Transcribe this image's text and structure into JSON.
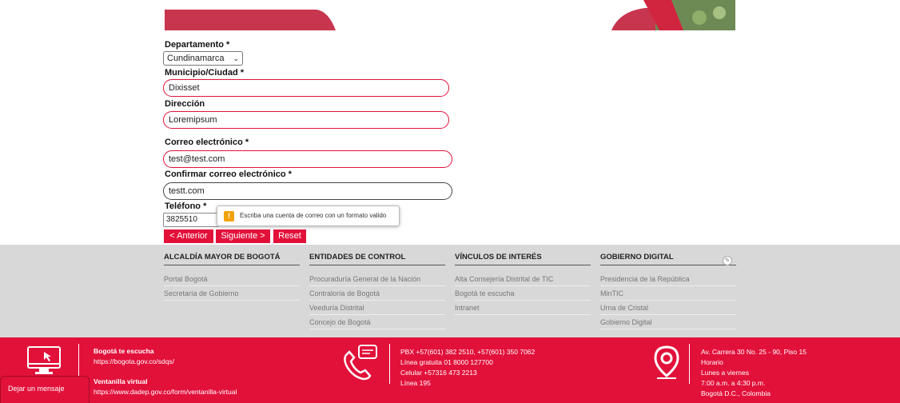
{
  "form": {
    "departamento_label": "Departamento",
    "departamento_value": "Cundinamarca",
    "municipio_label": "Municipio/Ciudad",
    "municipio_value": "Dixisset",
    "direccion_label": "Dirección",
    "direccion_value": "Loremipsum",
    "correo_label": "Correo electrónico",
    "correo_value": "test@test.com",
    "confirmar_label": "Confirmar correo electrónico",
    "confirmar_value": "testt.com",
    "telefono_label": "Teléfono",
    "telefono_value": "3825510",
    "required_mark": "*",
    "validation_tooltip": "Escriba una cuenta de correo con un formato valido",
    "buttons": {
      "anterior": "< Anterior",
      "siguiente": "Siguiente >",
      "reset": "Reset"
    }
  },
  "footer_nav": {
    "col1": {
      "title": "ALCALDÍA MAYOR DE BOGOTÁ",
      "items": [
        "Portal Bogotá",
        "Secretaría de Gobierno"
      ]
    },
    "col2": {
      "title": "ENTIDADES DE CONTROL",
      "items": [
        "Procuraduría General de la Nación",
        "Contraloría de Bogotá",
        "Veeduría Distrital",
        "Concejo de Bogotá"
      ]
    },
    "col3": {
      "title": "VÍNCULOS DE INTERÉS",
      "items": [
        "Alta Consejería Distrital de TIC",
        "Bogotá te escucha",
        "Intranet"
      ]
    },
    "col4": {
      "title": "GOBIERNO DIGITAL",
      "items": [
        "Presidencia de la República",
        "MinTIC",
        "Urna de Cristal",
        "Gobierno Digital"
      ]
    }
  },
  "footer_contact": {
    "bte_title": "Bogotá te escucha",
    "bte_url": "https://bogota.gov.co/sdqs/",
    "vv_title": "Ventanilla virtual",
    "vv_url": "https://www.dadep.gov.co/form/ventanilla-virtual",
    "pbx": "PBX +57(601) 382 2510, +57(601) 350 7062",
    "linea_gratuita": "Línea gratuita 01 8000 127700",
    "celular": "Celular +57316 473 2213",
    "linea195": "Línea 195",
    "address": "Av. Carrera 30 No. 25 - 90, Piso 15",
    "horario": "Horario",
    "dias": "Lunes a viernes",
    "horas": "7:00 a.m. a 4:30 p.m.",
    "ciudad": "Bogotá D.C., Colombia"
  },
  "chat": {
    "label": "Dejar un mensaje"
  },
  "colors": {
    "brand_red": "#e2113a",
    "footer_gray": "#d8d8d8",
    "warning": "#f2a20c"
  }
}
